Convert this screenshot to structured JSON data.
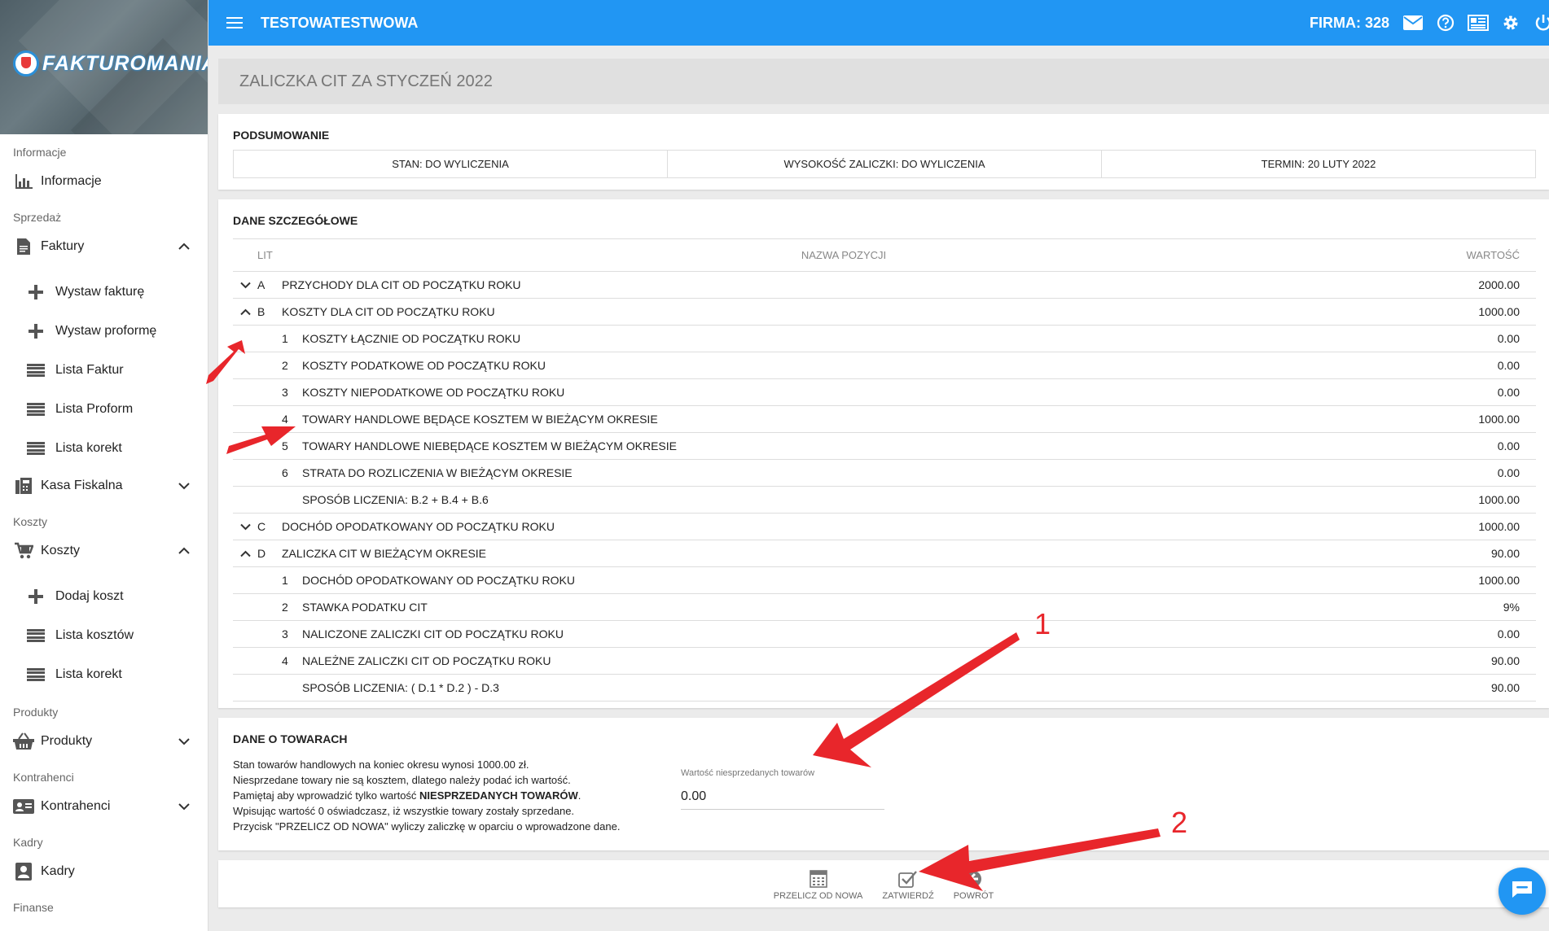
{
  "app": {
    "logo_text": "FAKTUROMANIA",
    "title": "TESTOWATESTWOWA",
    "firma": "FIRMA: 328"
  },
  "topbar_icons": [
    "mail-icon",
    "help-icon",
    "news-icon",
    "settings-icon",
    "power-icon"
  ],
  "sidebar": {
    "sections": {
      "informacje": "Informacje",
      "sprzedaz": "Sprzedaż",
      "koszty": "Koszty",
      "produkty": "Produkty",
      "kontrahenci": "Kontrahenci",
      "kadry": "Kadry",
      "finanse": "Finanse"
    },
    "items": {
      "informacje": "Informacje",
      "faktury": "Faktury",
      "wystaw_fakture": "Wystaw fakturę",
      "wystaw_proforme": "Wystaw proformę",
      "lista_faktur": "Lista Faktur",
      "lista_proform": "Lista Proform",
      "lista_korekt": "Lista korekt",
      "kasa_fiskalna": "Kasa Fiskalna",
      "koszty": "Koszty",
      "dodaj_koszt": "Dodaj koszt",
      "lista_kosztow": "Lista kosztów",
      "lista_korekt_koszty": "Lista korekt",
      "produkty": "Produkty",
      "kontrahenci": "Kontrahenci",
      "kadry": "Kadry"
    }
  },
  "page": {
    "title": "ZALICZKA CIT ZA STYCZEŃ 2022",
    "summary": {
      "title": "PODSUMOWANIE",
      "stan": "STAN: DO WYLICZENIA",
      "wysokosc": "WYSOKOŚĆ ZALICZKI: DO WYLICZENIA",
      "termin": "TERMIN: 20 LUTY 2022"
    },
    "details": {
      "title": "DANE SZCZEGÓŁOWE",
      "headers": {
        "lit": "LIT",
        "name": "NAZWA POZYCJI",
        "value": "WARTOŚĆ"
      },
      "rows": [
        {
          "expander": "v",
          "lit": "A",
          "sub": "",
          "name": "PRZYCHODY DLA CIT OD POCZĄTKU ROKU",
          "value": "2000.00"
        },
        {
          "expander": "^",
          "lit": "B",
          "sub": "",
          "name": "KOSZTY DLA CIT OD POCZĄTKU ROKU",
          "value": "1000.00"
        },
        {
          "expander": "",
          "lit": "",
          "sub": "1",
          "name": "KOSZTY ŁĄCZNIE OD POCZĄTKU ROKU",
          "value": "0.00"
        },
        {
          "expander": "",
          "lit": "",
          "sub": "2",
          "name": "KOSZTY PODATKOWE OD POCZĄTKU ROKU",
          "value": "0.00"
        },
        {
          "expander": "",
          "lit": "",
          "sub": "3",
          "name": "KOSZTY NIEPODATKOWE OD POCZĄTKU ROKU",
          "value": "0.00"
        },
        {
          "expander": "",
          "lit": "",
          "sub": "4",
          "name": "TOWARY HANDLOWE BĘDĄCE KOSZTEM W BIEŻĄCYM OKRESIE",
          "value": "1000.00"
        },
        {
          "expander": "",
          "lit": "",
          "sub": "5",
          "name": "TOWARY HANDLOWE NIEBĘDĄCE KOSZTEM W BIEŻĄCYM OKRESIE",
          "value": "0.00"
        },
        {
          "expander": "",
          "lit": "",
          "sub": "6",
          "name": "STRATA DO ROZLICZENIA W BIEŻĄCYM OKRESIE",
          "value": "0.00"
        },
        {
          "expander": "",
          "lit": "",
          "sub": "",
          "name": "SPOSÓB LICZENIA: B.2 + B.4 + B.6",
          "value": "1000.00"
        },
        {
          "expander": "v",
          "lit": "C",
          "sub": "",
          "name": "DOCHÓD OPODATKOWANY OD POCZĄTKU ROKU",
          "value": "1000.00"
        },
        {
          "expander": "^",
          "lit": "D",
          "sub": "",
          "name": "ZALICZKA CIT W BIEŻĄCYM OKRESIE",
          "value": "90.00"
        },
        {
          "expander": "",
          "lit": "",
          "sub": "1",
          "name": "DOCHÓD OPODATKOWANY OD POCZĄTKU ROKU",
          "value": "1000.00"
        },
        {
          "expander": "",
          "lit": "",
          "sub": "2",
          "name": "STAWKA PODATKU CIT",
          "value": "9%"
        },
        {
          "expander": "",
          "lit": "",
          "sub": "3",
          "name": "NALICZONE ZALICZKI CIT OD POCZĄTKU ROKU",
          "value": "0.00"
        },
        {
          "expander": "",
          "lit": "",
          "sub": "4",
          "name": "NALEŻNE ZALICZKI CIT OD POCZĄTKU ROKU",
          "value": "90.00"
        },
        {
          "expander": "",
          "lit": "",
          "sub": "",
          "name": "SPOSÓB LICZENIA: ( D.1 * D.2 ) - D.3",
          "value": "90.00"
        }
      ]
    },
    "towary": {
      "title": "DANE O TOWARACH",
      "line1": "Stan towarów handlowych na koniec okresu wynosi 1000.00 zł.",
      "line2": "Niesprzedane towary nie są kosztem, dlatego należy podać ich wartość.",
      "line3_pre": "Pamiętaj aby wprowadzić tylko wartość ",
      "line3_bold": "NIESPRZEDANYCH TOWARÓW",
      "line3_post": ".",
      "line4": "Wpisując wartość 0 oświadczasz, iż wszystkie towary zostały sprzedane.",
      "line5": "Przycisk \"PRZELICZ OD NOWA\" wyliczy zaliczkę w oparciu o wprowadzone dane.",
      "field_label": "Wartość niesprzedanych towarów",
      "field_value": "0.00"
    },
    "actions": {
      "recalc": "PRZELICZ OD NOWA",
      "confirm": "ZATWIERDŹ",
      "back": "POWRÓT"
    }
  },
  "annotations": {
    "num1": "1",
    "num2": "2",
    "color": "#e8262b"
  },
  "colors": {
    "accent": "#2196f3",
    "annotation": "#e8262b"
  }
}
